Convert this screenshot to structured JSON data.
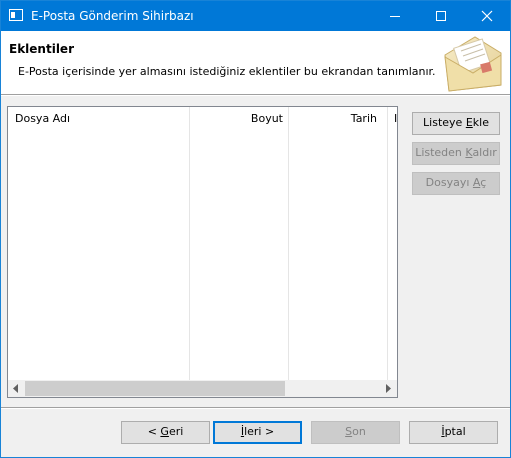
{
  "window": {
    "title": "E-Posta Gönderim Sihirbazı"
  },
  "header": {
    "title": "Eklentiler",
    "subtitle": "E-Posta içerisinde yer almasını istediğiniz eklentiler bu ekrandan tanımlanır."
  },
  "list": {
    "columns": [
      "Dosya Adı",
      "Boyut",
      "Tarih",
      "I"
    ],
    "rows": []
  },
  "side_buttons": {
    "add": {
      "pre": "Listeye ",
      "key": "E",
      "post": "kle",
      "enabled": true
    },
    "remove": {
      "pre": "Listeden ",
      "key": "K",
      "post": "aldır",
      "enabled": false
    },
    "open": {
      "pre": "Dosyayı ",
      "key": "A",
      "post": "ç",
      "enabled": false
    }
  },
  "footer_buttons": {
    "back": {
      "pre": "< ",
      "key": "G",
      "post": "eri",
      "enabled": true
    },
    "next": {
      "pre": "",
      "key": "İ",
      "post": "leri >",
      "enabled": true
    },
    "finish": {
      "pre": "",
      "key": "S",
      "post": "on",
      "enabled": false
    },
    "cancel": {
      "pre": "",
      "key": "İ",
      "post": "ptal",
      "enabled": true
    }
  },
  "colors": {
    "titlebar": "#0078d7",
    "dialog_bg": "#f0f0f0",
    "disabled_text": "#838383"
  },
  "icons": [
    "app-icon",
    "minimize-icon",
    "maximize-icon",
    "close-icon",
    "envelope-icon",
    "scroll-left-icon",
    "scroll-right-icon"
  ]
}
